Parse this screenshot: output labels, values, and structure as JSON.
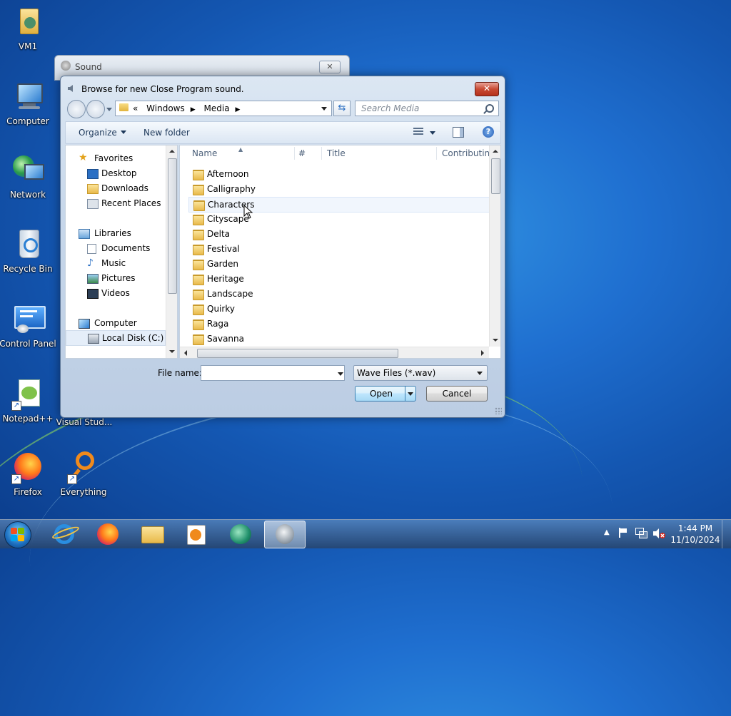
{
  "desktop": {
    "icons": [
      {
        "label": "VM1",
        "icon": "user-folder-icon"
      },
      {
        "label": "Computer",
        "icon": "computer-icon"
      },
      {
        "label": "Network",
        "icon": "network-icon"
      },
      {
        "label": "Recycle Bin",
        "icon": "recycle-bin-icon"
      },
      {
        "label": "Control Panel",
        "icon": "control-panel-icon"
      },
      {
        "label": "Notepad++",
        "icon": "notepadpp-icon"
      },
      {
        "label": "Microsoft Visual Stud...",
        "icon": "visual-studio-icon"
      },
      {
        "label": "Firefox",
        "icon": "firefox-icon"
      },
      {
        "label": "Everything",
        "icon": "everything-icon"
      }
    ]
  },
  "sound_window": {
    "title": "Sound",
    "close_label": "✕"
  },
  "dialog": {
    "title": "Browse for new Close Program sound.",
    "close_label": "✕",
    "address": {
      "prefix": "«",
      "crumbs": [
        "Windows",
        "Media"
      ]
    },
    "search_placeholder": "Search Media",
    "toolbar": {
      "organize": "Organize",
      "new_folder": "New folder",
      "help": "?"
    },
    "nav": {
      "favorites": "Favorites",
      "favorites_items": [
        "Desktop",
        "Downloads",
        "Recent Places"
      ],
      "libraries": "Libraries",
      "libraries_items": [
        "Documents",
        "Music",
        "Pictures",
        "Videos"
      ],
      "computer": "Computer",
      "computer_items": [
        "Local Disk (C:)"
      ]
    },
    "columns": {
      "name": "Name",
      "number": "#",
      "title": "Title",
      "contributing": "Contributing"
    },
    "folders": [
      "Afternoon",
      "Calligraphy",
      "Characters",
      "Cityscape",
      "Delta",
      "Festival",
      "Garden",
      "Heritage",
      "Landscape",
      "Quirky",
      "Raga",
      "Savanna"
    ],
    "hovered_folder": "Characters",
    "file_name_label": "File name:",
    "file_name_value": "",
    "file_type": "Wave Files (*.wav)",
    "open_label": "Open",
    "cancel_label": "Cancel"
  },
  "taskbar": {
    "apps": [
      "internet-explorer-icon",
      "firefox-icon",
      "file-explorer-icon",
      "media-player-icon",
      "app-icon",
      "sound-icon"
    ],
    "tray_icons": [
      "show-hidden-icon",
      "action-center-flag-icon",
      "network-icon",
      "volume-muted-icon"
    ],
    "time": "1:44 PM",
    "date": "11/10/2024"
  },
  "colors": {
    "accent": "#1f6fd0",
    "close_red": "#c84a33",
    "folder_yellow": "#e8b94a"
  }
}
